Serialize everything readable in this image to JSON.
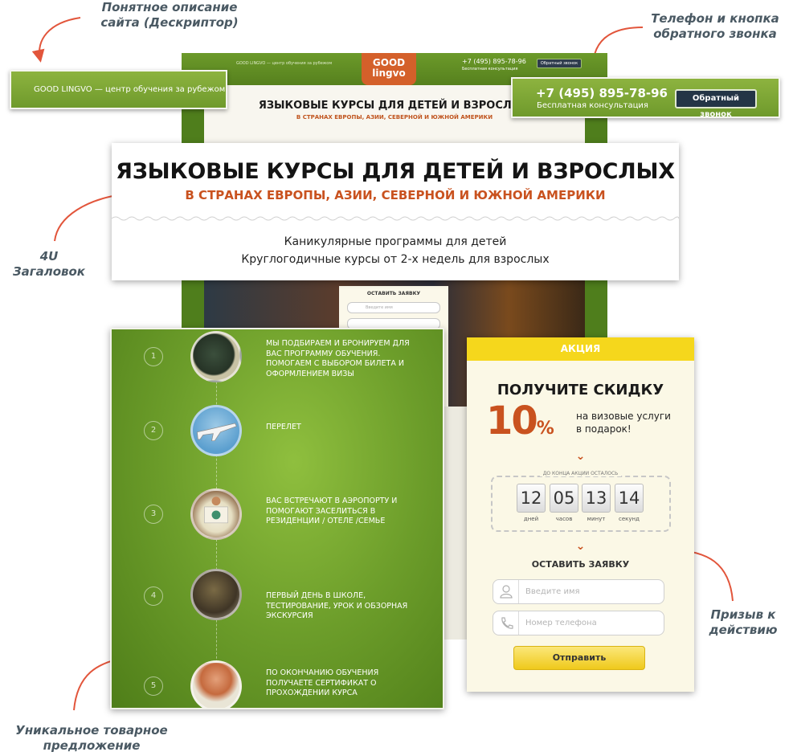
{
  "annotations": {
    "descriptor": "Понятное описание сайта (Дескриптор)",
    "phone": "Телефон и кнопка обратного звонка",
    "headline": "4U Загаловок",
    "usp": "Уникальное товарное предложение",
    "cta": "Призыв к действию"
  },
  "site": {
    "descriptor": "GOOD LINGVO — центр обучения за рубежом",
    "logo_line1": "GOOD",
    "logo_line2": "lingvo",
    "phone": "+7 (495) 895-78-96",
    "consult": "Бесплатная консультация",
    "callback": "Обратный звонок",
    "hero_title": "ЯЗЫКОВЫЕ КУРСЫ ДЛЯ ДЕТЕЙ И ВЗРОСЛЫХ",
    "hero_sub": "В СТРАНАХ ЕВРОПЫ, АЗИИ, СЕВЕРНОЙ И ЮЖНОЙ АМЕРИКИ",
    "form_title": "ОСТАВИТЬ ЗАЯВКУ",
    "name_placeholder": "Введите имя"
  },
  "descriptor_box": {
    "text": "GOOD LINGVO — центр обучения за рубежом"
  },
  "phone_box": {
    "phone": "+7 (495) 895-78-96",
    "sub": "Бесплатная консультация",
    "button": "Обратный звонок"
  },
  "headline": {
    "title": "ЯЗЫКОВЫЕ КУРСЫ ДЛЯ ДЕТЕЙ И ВЗРОСЛЫХ",
    "subtitle": "В СТРАНАХ ЕВРОПЫ, АЗИИ, СЕВЕРНОЙ И ЮЖНОЙ АМЕРИКИ",
    "line1": "Каникулярные программы для детей",
    "line2": "Круглогодичные курсы от 2-х недель для взрослых"
  },
  "steps": [
    {
      "num": "1",
      "icon": "passport-icon",
      "text": "Мы подбираем и бронируем для вас программу обучения. Помогаем с выбором билета и оформлением визы"
    },
    {
      "num": "2",
      "icon": "airplane-icon",
      "text": "Перелет"
    },
    {
      "num": "3",
      "icon": "greeting-person-icon",
      "text": "Вас встречают в аэропорту и помогают заселиться в резиденции / отеле /семье"
    },
    {
      "num": "4",
      "icon": "tour-guide-icon",
      "text": "Первый день в школе, тестирование, урок и обзорная экскурсия"
    },
    {
      "num": "5",
      "icon": "certificate-icon",
      "text": "По окончанию обучения получаете сертификат о прохождении курса"
    }
  ],
  "promo": {
    "header": "АКЦИЯ",
    "title": "ПОЛУЧИТЕ СКИДКУ",
    "percent": "10",
    "percent_sign": "%",
    "desc_line1": "на визовые услуги",
    "desc_line2": "в подарок!",
    "timer_label": "ДО КОНЦА АКЦИИ ОСТАЛОСЬ",
    "timer": [
      {
        "value": "12",
        "unit": "дней"
      },
      {
        "value": "05",
        "unit": "часов"
      },
      {
        "value": "13",
        "unit": "минут"
      },
      {
        "value": "14",
        "unit": "секунд"
      }
    ],
    "form_title": "ОСТАВИТЬ ЗАЯВКУ",
    "name_placeholder": "Введите имя",
    "phone_placeholder": "Номер телефона",
    "submit": "Отправить"
  },
  "colors": {
    "green": "#6f9a2c",
    "orange": "#c9521f",
    "yellow": "#f5d71c",
    "navy": "#243546"
  }
}
